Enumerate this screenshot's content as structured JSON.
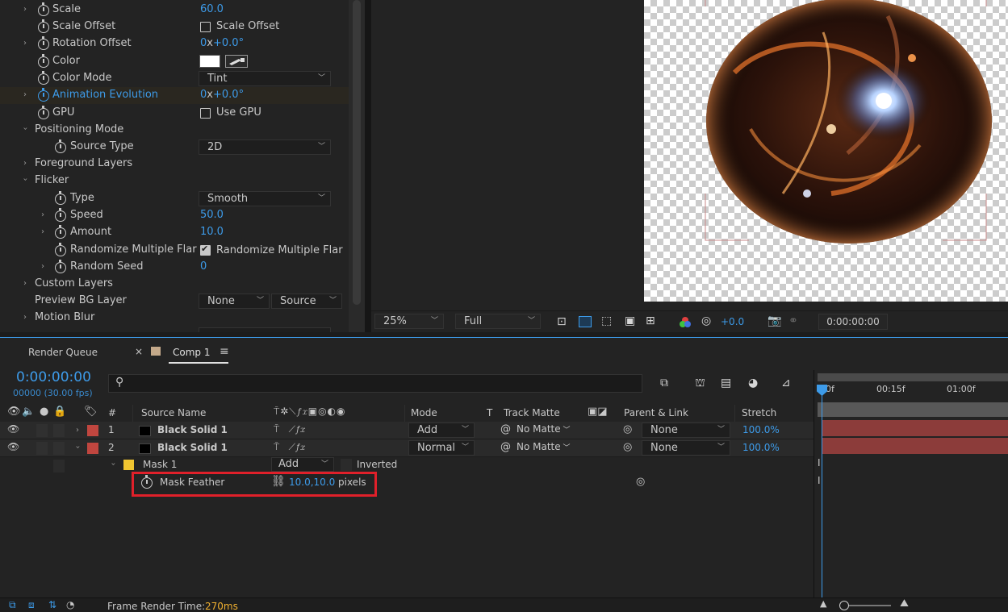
{
  "effect_controls": {
    "rows": [
      {
        "label": "Scale",
        "value": "60.0"
      },
      {
        "label": "Scale Offset",
        "value": "Scale Offset"
      },
      {
        "label": "Rotation Offset",
        "value_prefix": "0",
        "value_x": "x",
        "value_suffix": "+0.0",
        "degree": "°"
      },
      {
        "label": "Color"
      },
      {
        "label": "Color Mode",
        "value": "Tint"
      },
      {
        "label": "Animation Evolution",
        "value_prefix": "0",
        "value_x": "x",
        "value_suffix": "+0.0",
        "degree": "°"
      },
      {
        "label": "GPU",
        "value": "Use GPU"
      },
      {
        "label": "Positioning Mode"
      },
      {
        "label": "Source Type",
        "value": "2D"
      },
      {
        "label": "Foreground Layers"
      },
      {
        "label": "Flicker"
      },
      {
        "label": "Type",
        "value": "Smooth"
      },
      {
        "label": "Speed",
        "value": "50.0"
      },
      {
        "label": "Amount",
        "value": "10.0"
      },
      {
        "label": "Randomize Multiple Flar",
        "value": "Randomize Multiple Flar"
      },
      {
        "label": "Random Seed",
        "value": "0"
      },
      {
        "label": "Custom Layers"
      },
      {
        "label": "Preview BG Layer",
        "value": "None",
        "value2": "Source"
      },
      {
        "label": "Motion Blur"
      }
    ]
  },
  "viewer_toolbar": {
    "zoom": "25%",
    "resolution": "Full",
    "exposure": "+0.0",
    "timecode": "0:00:00:00"
  },
  "tabs": {
    "render_queue": "Render Queue",
    "comp": "Comp 1"
  },
  "timeline": {
    "timecode": "0:00:00:00",
    "frame_info": "00000 (30.00 fps)",
    "search_icon": "search-icon",
    "columns": {
      "hash": "#",
      "source_name": "Source Name",
      "mode": "Mode",
      "t": "T",
      "track_matte": "Track Matte",
      "parent_link": "Parent & Link",
      "stretch": "Stretch"
    },
    "ruler": [
      "0f",
      "00:15f",
      "01:00f"
    ],
    "layers": [
      {
        "num": "1",
        "name": "Black Solid 1",
        "mode": "Add",
        "matte": "No Matte",
        "parent": "None",
        "stretch": "100.0%"
      },
      {
        "num": "2",
        "name": "Black Solid 1",
        "mode": "Normal",
        "matte": "No Matte",
        "parent": "None",
        "stretch": "100.0%"
      }
    ],
    "mask": {
      "name": "Mask 1",
      "mode": "Add",
      "inverted": "Inverted"
    },
    "mask_feather": {
      "label": "Mask Feather",
      "value": "10.0,10.0",
      "unit": "pixels"
    }
  },
  "status": {
    "label": "Frame Render Time:",
    "value": "270ms"
  },
  "colors": {
    "accent_blue": "#3d9be9",
    "highlight_red": "#e0202a",
    "layer_red": "#c0463f",
    "bar_red": "#8c3c3a"
  }
}
